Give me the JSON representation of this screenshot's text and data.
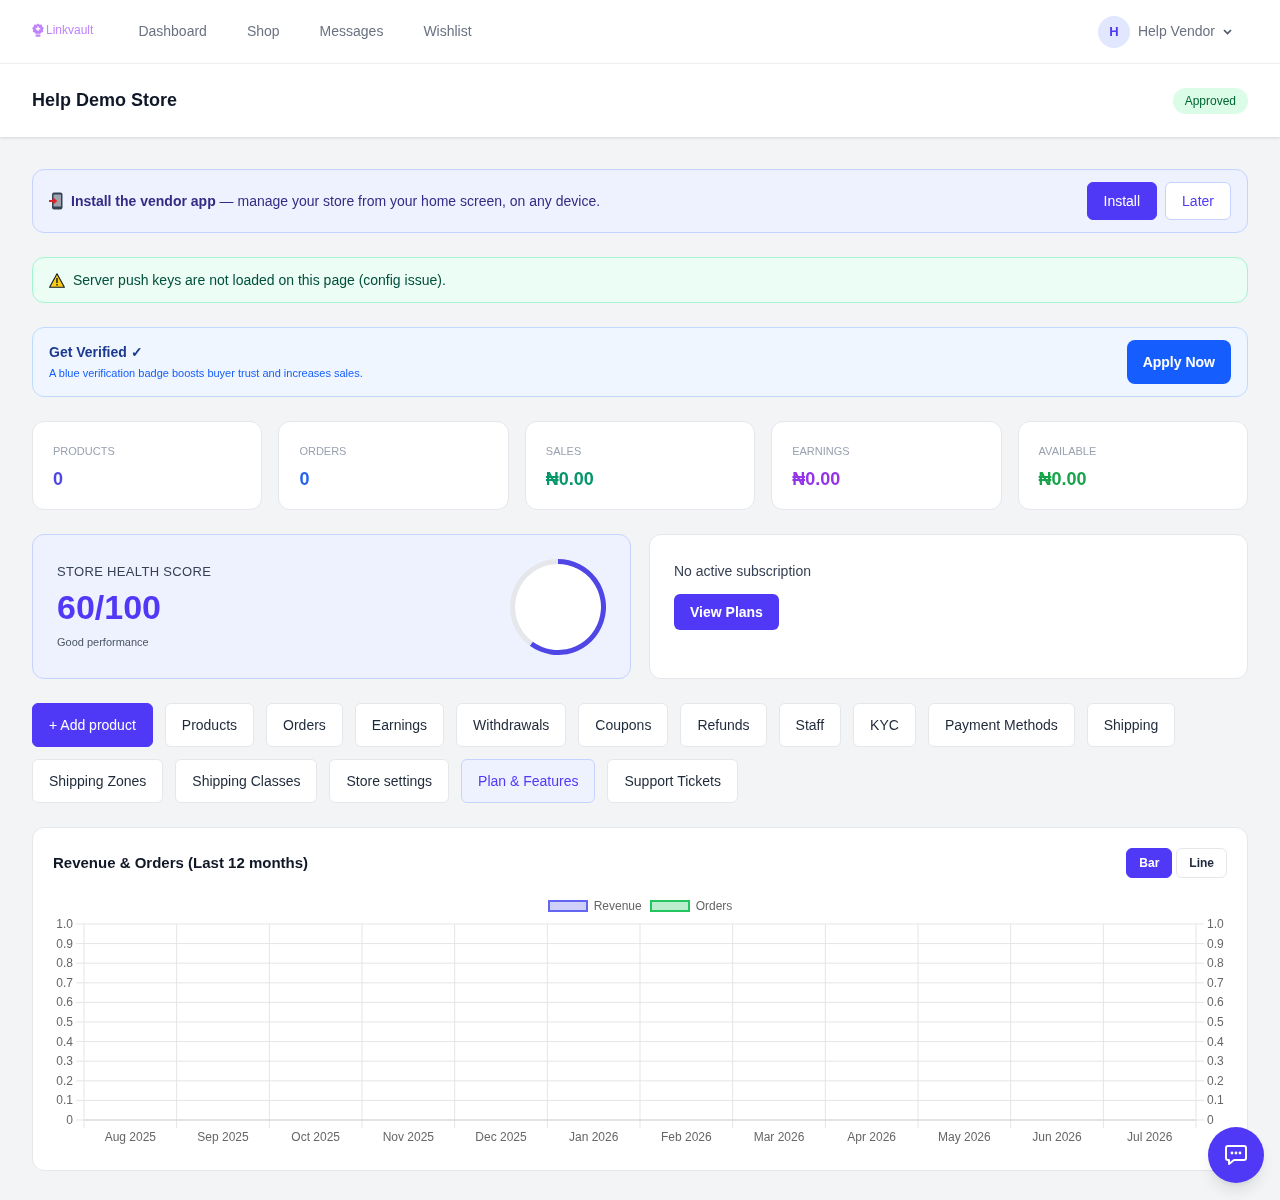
{
  "nav": {
    "logo": "Linkvault",
    "links": [
      "Dashboard",
      "Shop",
      "Messages",
      "Wishlist"
    ],
    "user": {
      "initial": "H",
      "name": "Help Vendor"
    }
  },
  "store": {
    "name": "Help Demo Store",
    "status": "Approved"
  },
  "install_banner": {
    "text": "**Install the vendor app** — manage your store from your home screen, on any device.",
    "buttons": [
      {
        "label": "Install",
        "kind": "primary"
      },
      {
        "label": "Later",
        "kind": "secondary"
      }
    ]
  },
  "warning": {
    "text": "Server push keys are not loaded on this page (config issue)."
  },
  "verify": {
    "title": "Get Verified ✓",
    "subtitle": "A blue verification badge boosts buyer trust and increases sales.",
    "button": "Apply Now"
  },
  "stats": [
    {
      "label": "PRODUCTS",
      "value": "0",
      "color": "#4f46e5"
    },
    {
      "label": "ORDERS",
      "value": "0",
      "color": "#2563eb"
    },
    {
      "label": "SALES",
      "value": "₦0.00",
      "color": "#059669"
    },
    {
      "label": "EARNINGS",
      "value": "₦0.00",
      "color": "#9333ea"
    },
    {
      "label": "AVAILABLE",
      "value": "₦0.00",
      "color": "#16a34a"
    }
  ],
  "health": {
    "title": "STORE HEALTH SCORE",
    "score": "60/100",
    "note": "Good performance",
    "chart_data": {
      "type": "donut",
      "values": [
        60,
        40
      ]
    }
  },
  "subscription": {
    "text": "No active subscription",
    "button": "View Plans"
  },
  "actions": [
    {
      "label": "+ Add product",
      "kind": "primary"
    },
    {
      "label": "Products",
      "kind": "default"
    },
    {
      "label": "Orders",
      "kind": "default"
    },
    {
      "label": "Earnings",
      "kind": "default"
    },
    {
      "label": "Withdrawals",
      "kind": "default"
    },
    {
      "label": "Coupons",
      "kind": "default"
    },
    {
      "label": "Refunds",
      "kind": "default"
    },
    {
      "label": "Staff",
      "kind": "default"
    },
    {
      "label": "KYC",
      "kind": "default"
    },
    {
      "label": "Payment Methods",
      "kind": "default"
    },
    {
      "label": "Shipping",
      "kind": "default"
    },
    {
      "label": "Shipping Zones",
      "kind": "default"
    },
    {
      "label": "Shipping Classes",
      "kind": "default"
    },
    {
      "label": "Store settings",
      "kind": "default"
    },
    {
      "label": "Plan & Features",
      "kind": "highlight"
    },
    {
      "label": "Support Tickets",
      "kind": "default"
    }
  ],
  "chart": {
    "toggle": [
      {
        "label": "Bar",
        "selected": true
      },
      {
        "label": "Line",
        "selected": false
      }
    ],
    "right_axis_labels": [
      "1.0",
      "0.9",
      "0.8",
      "0.7",
      "0.6",
      "0.5",
      "0.4",
      "0.3",
      "0.2",
      "0.1",
      "0"
    ],
    "chart_data": {
      "type": "bar",
      "title": "Revenue & Orders (Last 12 months)",
      "categories": [
        "Aug 2025",
        "Sep 2025",
        "Oct 2025",
        "Nov 2025",
        "Dec 2025",
        "Jan 2026",
        "Feb 2026",
        "Mar 2026",
        "Apr 2026",
        "May 2026",
        "Jun 2026",
        "Jul 2026"
      ],
      "series": [
        {
          "name": "Revenue",
          "color": "#6366f1",
          "values": [
            0,
            0,
            0,
            0,
            0,
            0,
            0,
            0,
            0,
            0,
            0,
            0
          ]
        },
        {
          "name": "Orders",
          "color": "#22c55e",
          "values": [
            0,
            0,
            0,
            0,
            0,
            0,
            0,
            0,
            0,
            0,
            0,
            0
          ]
        }
      ],
      "ylim": [
        0,
        1
      ],
      "yticks": [
        0,
        0.1,
        0.2,
        0.3,
        0.4,
        0.5,
        0.6,
        0.7,
        0.8,
        0.9,
        {
          "value": 1,
          "label": "1.0"
        }
      ],
      "grid": true
    }
  }
}
